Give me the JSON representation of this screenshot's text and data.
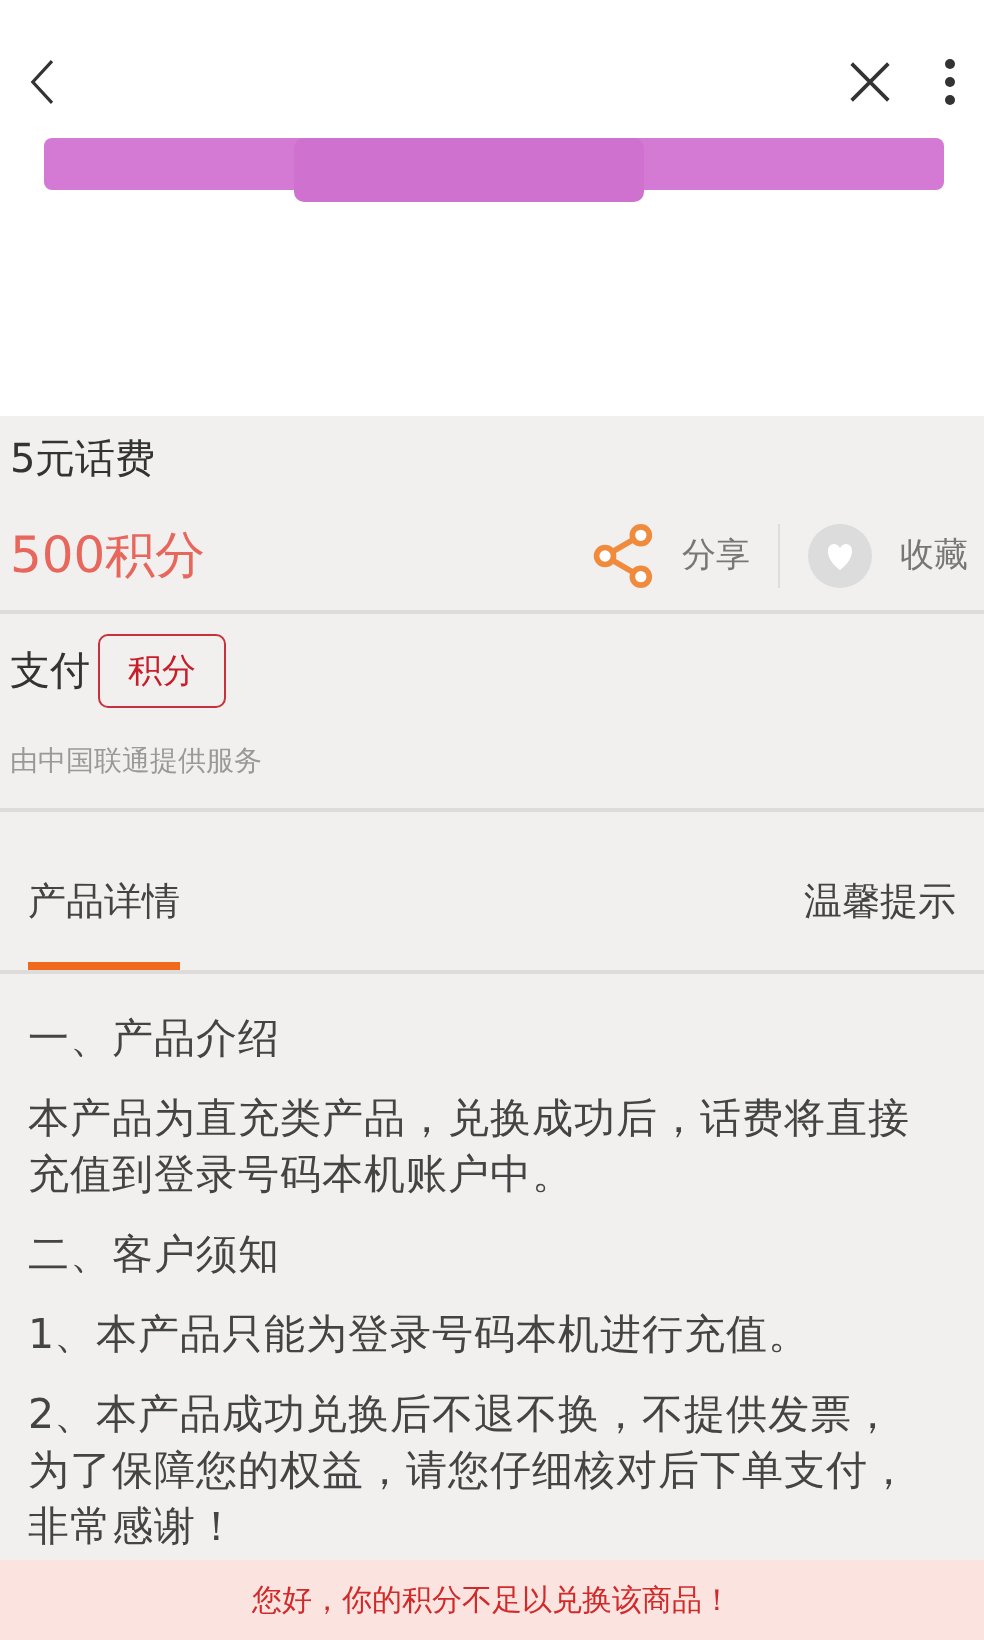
{
  "product": {
    "name": "5元话费",
    "price": "500积分",
    "actions": [
      {
        "kind": "share",
        "label": "分享"
      },
      {
        "kind": "favorite",
        "label": "收藏"
      }
    ]
  },
  "payment": {
    "label": "支付",
    "method": "积分",
    "provider": "由中国联通提供服务"
  },
  "tabs": [
    {
      "label": "产品详情",
      "selected": true
    },
    {
      "label": "温馨提示",
      "selected": false
    }
  ],
  "details": [
    "一、产品介绍",
    "本产品为直充类产品，兑换成功后，话费将直接充值到登录号码本机账户中。",
    "二、客户须知",
    "1、本产品只能为登录号码本机进行充值。",
    "2、本产品成功兑换后不退不换，不提供发票，为了保障您的权益，请您仔细核对后下单支付，非常感谢！"
  ],
  "notice": "您好，你的积分不足以兑换该商品！"
}
